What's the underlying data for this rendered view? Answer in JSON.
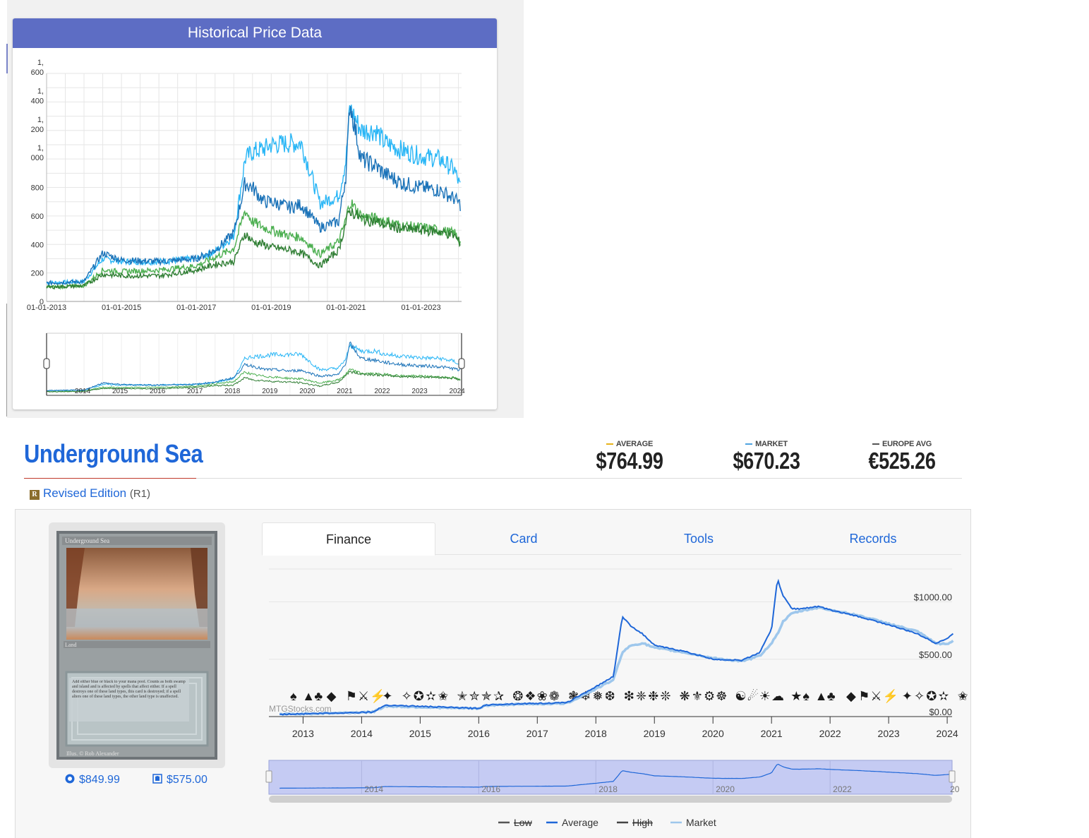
{
  "top_panel": {
    "header": "Historical Price Data"
  },
  "card": {
    "name": "Underground Sea",
    "set_name": "Revised Edition",
    "set_code": "(R1)",
    "set_icon_letter": "R",
    "tcg_price": "$849.99",
    "ck_price": "$575.00",
    "type_line": "Land",
    "rules_text": "Add either blue or black to your mana pool. Counts as both swamp and island and is affected by spells that affect either. If a spell destroys one of these land types, this card is destroyed; if a spell alters one of these land types, the other land type is unaffected.",
    "illus": "Illus. © Rob Alexander"
  },
  "stats": [
    {
      "label": "AVERAGE",
      "value": "$764.99",
      "color": "#e8b31b"
    },
    {
      "label": "MARKET",
      "value": "$670.23",
      "color": "#4fa3e0"
    },
    {
      "label": "EUROPE AVG",
      "value": "€525.26",
      "color": "#555555"
    }
  ],
  "tabs": [
    {
      "label": "Finance",
      "active": true
    },
    {
      "label": "Card",
      "active": false
    },
    {
      "label": "Tools",
      "active": false
    },
    {
      "label": "Records",
      "active": false
    }
  ],
  "chart_data": [
    {
      "type": "line",
      "title": "Historical Price Data",
      "x_range": [
        "2013-01-01",
        "2024-02-01"
      ],
      "x_tick_labels": [
        "01-01-2013",
        "01-01-2015",
        "01-01-2017",
        "01-01-2019",
        "01-01-2021",
        "01-01-2023"
      ],
      "y_tick_labels": [
        "0",
        "200",
        "400",
        "600",
        "800",
        "1, 000",
        "1, 200",
        "1, 400",
        "1, 600"
      ],
      "ylim": [
        0,
        1600
      ],
      "grid": true,
      "navigator_labels": [
        "2014",
        "2015",
        "2016",
        "2017",
        "2018",
        "2019",
        "2020",
        "2021",
        "2022",
        "2023",
        "2024"
      ],
      "series": [
        {
          "color": "#29b6f6",
          "x": [
            2013.0,
            2014.0,
            2014.5,
            2015.0,
            2016.0,
            2017.0,
            2017.5,
            2018.0,
            2018.3,
            2018.5,
            2018.8,
            2019.0,
            2019.5,
            2019.8,
            2020.3,
            2020.8,
            2021.0,
            2021.1,
            2021.4,
            2021.8,
            2022.0,
            2022.5,
            2023.0,
            2023.5,
            2023.9,
            2024.05
          ],
          "y": [
            130,
            140,
            300,
            280,
            280,
            300,
            350,
            460,
            1000,
            1050,
            1070,
            1100,
            1110,
            1110,
            690,
            740,
            1000,
            1360,
            1200,
            1200,
            1120,
            1060,
            1020,
            1000,
            920,
            800
          ]
        },
        {
          "color": "#1a72b8",
          "x": [
            2013.0,
            2014.0,
            2014.5,
            2015.0,
            2016.0,
            2017.0,
            2017.5,
            2018.0,
            2018.3,
            2018.5,
            2018.8,
            2019.0,
            2019.5,
            2019.8,
            2020.3,
            2020.8,
            2021.0,
            2021.1,
            2021.4,
            2021.8,
            2022.0,
            2022.5,
            2023.0,
            2023.5,
            2023.9,
            2024.05
          ],
          "y": [
            130,
            140,
            340,
            290,
            280,
            300,
            360,
            480,
            830,
            800,
            700,
            700,
            660,
            680,
            520,
            560,
            900,
            1400,
            1000,
            950,
            900,
            830,
            800,
            780,
            720,
            680
          ]
        },
        {
          "color": "#4caf50",
          "x": [
            2013.0,
            2014.0,
            2014.5,
            2015.0,
            2016.0,
            2017.0,
            2017.5,
            2018.0,
            2018.3,
            2018.5,
            2018.8,
            2019.0,
            2019.5,
            2019.8,
            2020.3,
            2020.8,
            2021.0,
            2021.1,
            2021.4,
            2021.8,
            2022.0,
            2022.5,
            2023.0,
            2023.5,
            2023.9,
            2024.05
          ],
          "y": [
            100,
            110,
            220,
            210,
            220,
            250,
            310,
            370,
            640,
            560,
            520,
            500,
            460,
            450,
            330,
            420,
            580,
            700,
            600,
            580,
            570,
            530,
            520,
            500,
            480,
            410
          ]
        },
        {
          "color": "#2e7d32",
          "x": [
            2013.0,
            2014.0,
            2014.5,
            2015.0,
            2016.0,
            2017.0,
            2017.5,
            2018.0,
            2018.3,
            2018.5,
            2018.8,
            2019.0,
            2019.5,
            2019.8,
            2020.3,
            2020.8,
            2021.0,
            2021.1,
            2021.4,
            2021.8,
            2022.0,
            2022.5,
            2023.0,
            2023.5,
            2023.9,
            2024.05
          ],
          "y": [
            100,
            110,
            190,
            180,
            180,
            220,
            260,
            280,
            480,
            420,
            400,
            380,
            360,
            340,
            250,
            360,
            560,
            640,
            580,
            560,
            540,
            510,
            500,
            490,
            460,
            410
          ]
        }
      ]
    },
    {
      "type": "line",
      "watermark": "MTGStocks.com",
      "x_range": [
        "2012-06-01",
        "2024-02-01"
      ],
      "x_tick_labels": [
        "2013",
        "2014",
        "2015",
        "2016",
        "2017",
        "2018",
        "2019",
        "2020",
        "2021",
        "2022",
        "2023",
        "2024"
      ],
      "y_tick_labels": [
        "$1000.00",
        "$500.00",
        "$0.00"
      ],
      "ylim": [
        0,
        1200
      ],
      "navigator_labels": [
        "2014",
        "2016",
        "2018",
        "2020",
        "2022",
        "20"
      ],
      "legend": [
        "Low",
        "Average",
        "High",
        "Market"
      ],
      "legend_placement": "bottom-center",
      "series": [
        {
          "name": "Average",
          "color": "#1f67d8",
          "x": [
            2012.6,
            2013.5,
            2014.2,
            2014.4,
            2015.5,
            2016.0,
            2016.1,
            2016.5,
            2017.5,
            2018.0,
            2018.3,
            2018.45,
            2018.6,
            2018.8,
            2019.0,
            2019.5,
            2020.0,
            2020.5,
            2020.8,
            2021.0,
            2021.1,
            2021.2,
            2021.35,
            2021.5,
            2021.8,
            2022.0,
            2022.5,
            2023.0,
            2023.5,
            2023.8,
            2024.0,
            2024.1
          ],
          "y": [
            20,
            30,
            40,
            100,
            80,
            70,
            100,
            110,
            120,
            260,
            350,
            870,
            790,
            720,
            620,
            570,
            500,
            490,
            560,
            760,
            1200,
            1050,
            940,
            940,
            960,
            930,
            870,
            800,
            720,
            640,
            680,
            720
          ]
        },
        {
          "name": "Market",
          "color": "#9ec7ec",
          "x": [
            2012.6,
            2013.5,
            2014.2,
            2014.4,
            2015.5,
            2016.0,
            2016.1,
            2016.5,
            2017.5,
            2018.0,
            2018.3,
            2018.45,
            2018.6,
            2018.8,
            2019.0,
            2019.5,
            2020.0,
            2020.5,
            2020.8,
            2021.0,
            2021.1,
            2021.2,
            2021.35,
            2021.5,
            2021.8,
            2022.0,
            2022.5,
            2023.0,
            2023.5,
            2023.8,
            2024.0,
            2024.1
          ],
          "y": [
            20,
            30,
            40,
            90,
            75,
            70,
            95,
            105,
            115,
            240,
            320,
            560,
            620,
            640,
            600,
            560,
            510,
            480,
            530,
            640,
            720,
            830,
            900,
            920,
            950,
            930,
            880,
            810,
            740,
            640,
            630,
            660
          ]
        },
        {
          "name": "Low",
          "color": "#555555",
          "x": [],
          "y": []
        },
        {
          "name": "High",
          "color": "#444444",
          "x": [],
          "y": []
        }
      ]
    }
  ]
}
